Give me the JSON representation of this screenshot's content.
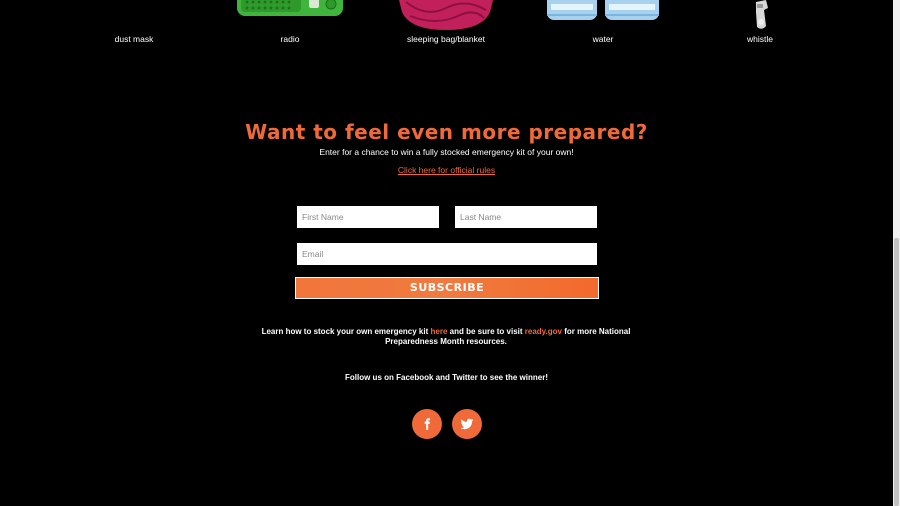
{
  "items": [
    {
      "label": "dust mask"
    },
    {
      "label": "radio"
    },
    {
      "label": "sleeping bag/blanket"
    },
    {
      "label": "water"
    },
    {
      "label": "whistle"
    }
  ],
  "promo": {
    "headline": "Want to feel even more prepared?",
    "subtext": "Enter for a chance to win a fully stocked emergency kit of your own!",
    "rules_link": "Click here for official rules"
  },
  "form": {
    "first_name_placeholder": "First Name",
    "last_name_placeholder": "Last Name",
    "email_placeholder": "Email",
    "subscribe_label": "SUBSCRIBE"
  },
  "footer": {
    "learn_pre": "Learn how to stock your own emergency kit ",
    "learn_link": "here",
    "learn_mid": " and be sure to visit ",
    "ready_link": "ready.gov",
    "learn_post": " for more National Preparedness Month resources.",
    "follow_text": "Follow us on Facebook and Twitter to see the winner!"
  },
  "social": [
    {
      "icon": "facebook-icon"
    },
    {
      "icon": "twitter-icon"
    }
  ],
  "colors": {
    "accent": "#ef6a38",
    "background": "#000000",
    "text": "#ffffff"
  }
}
